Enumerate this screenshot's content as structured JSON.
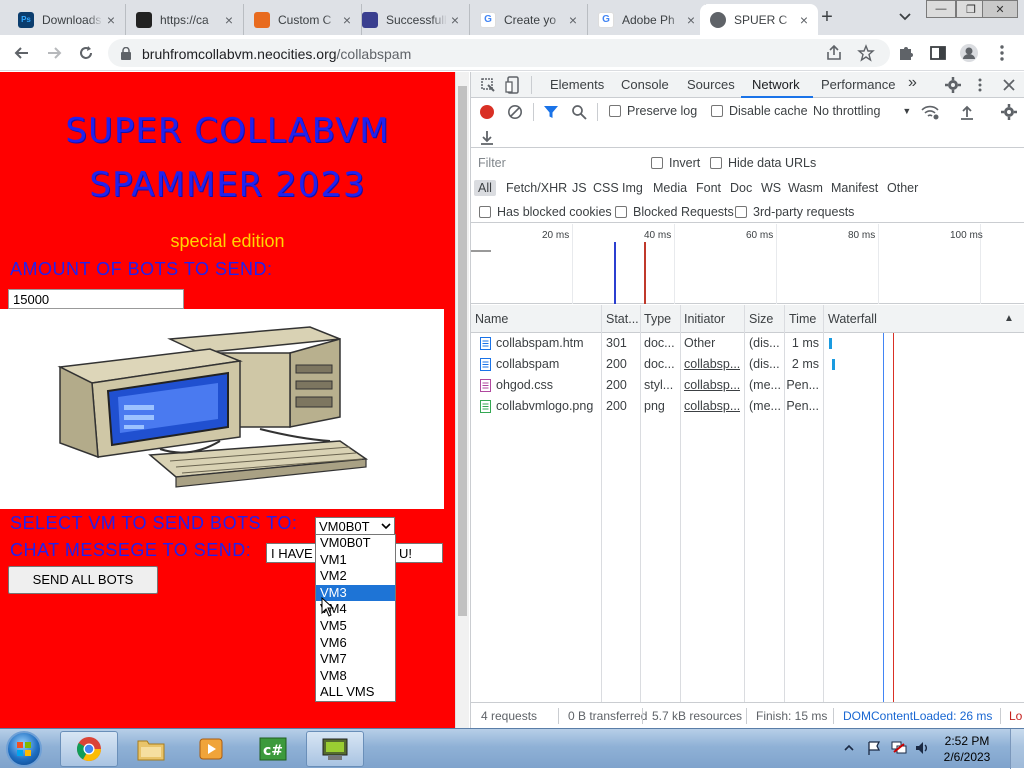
{
  "browser": {
    "tabs": [
      {
        "title": "Downloads",
        "icon": "photoshop-icon"
      },
      {
        "title": "https://ca",
        "icon": "camera-icon"
      },
      {
        "title": "Custom C",
        "icon": "paint-icon"
      },
      {
        "title": "Successfully",
        "icon": "arrow-icon"
      },
      {
        "title": "Create yo",
        "icon": "google-icon"
      },
      {
        "title": "Adobe Ph",
        "icon": "google-icon"
      },
      {
        "title": "SPUER C",
        "icon": "globe-icon",
        "active": true
      }
    ],
    "url_domain": "bruhfromcollabvm.neocities.org",
    "url_path": "/collabspam"
  },
  "page": {
    "headline": "SUPER COLLABVM SPAMMER 2023",
    "subtitle": "special edition",
    "bots_label": "AMOUNT OF BOTS TO SEND:",
    "bots_value": "15000",
    "vm_label": "SELECT VM TO SEND BOTS TO:",
    "vm_selected": "VM0B0T",
    "chat_label": "CHAT MESSEGE TO SEND:",
    "chat_value_left": "I HAVE",
    "chat_value_right": "U!",
    "send_button": "SEND ALL BOTS",
    "vm_options": [
      "VM0B0T",
      "VM1",
      "VM2",
      "VM3",
      "VM4",
      "VM5",
      "VM6",
      "VM7",
      "VM8",
      "ALL VMS"
    ],
    "vm_highlighted": "VM3"
  },
  "devtools": {
    "tabs": [
      "Elements",
      "Console",
      "Sources",
      "Network",
      "Performance"
    ],
    "active_tab": "Network",
    "toolbar": {
      "preserve_log": "Preserve log",
      "disable_cache": "Disable cache",
      "throttling": "No throttling"
    },
    "filter": {
      "placeholder": "Filter",
      "invert": "Invert",
      "hide_data_urls": "Hide data URLs",
      "types": [
        "All",
        "Fetch/XHR",
        "JS",
        "CSS",
        "Img",
        "Media",
        "Font",
        "Doc",
        "WS",
        "Wasm",
        "Manifest",
        "Other"
      ],
      "active_type": "All",
      "has_blocked_cookies": "Has blocked cookies",
      "blocked_requests": "Blocked Requests",
      "third_party": "3rd-party requests"
    },
    "overview_ticks": [
      "20 ms",
      "40 ms",
      "60 ms",
      "80 ms",
      "100 ms"
    ],
    "columns": [
      "Name",
      "Stat...",
      "Type",
      "Initiator",
      "Size",
      "Time",
      "Waterfall"
    ],
    "requests": [
      {
        "name": "collabspam.htm",
        "status": "301",
        "type": "doc...",
        "initiator": "Other",
        "size": "(dis...",
        "time": "1 ms",
        "kind": "doc"
      },
      {
        "name": "collabspam",
        "status": "200",
        "type": "doc...",
        "initiator": "collabsp...",
        "size": "(dis...",
        "time": "2 ms",
        "kind": "doc"
      },
      {
        "name": "ohgod.css",
        "status": "200",
        "type": "styl...",
        "initiator": "collabsp...",
        "size": "(me...",
        "time": "Pen...",
        "kind": "css"
      },
      {
        "name": "collabvmlogo.png",
        "status": "200",
        "type": "png",
        "initiator": "collabsp...",
        "size": "(me...",
        "time": "Pen...",
        "kind": "img"
      }
    ],
    "status": {
      "requests": "4 requests",
      "transferred": "0 B transferred",
      "resources": "5.7 kB resources",
      "finish": "Finish: 15 ms",
      "dcl": "DOMContentLoaded: 26 ms",
      "load": "Lo"
    }
  },
  "taskbar": {
    "time": "2:52 PM",
    "date": "2/6/2023"
  },
  "colors": {
    "page_bg": "#ff0000",
    "headline": "#2222ee",
    "subtitle": "#ffd400",
    "accent": "#1a73e8"
  }
}
